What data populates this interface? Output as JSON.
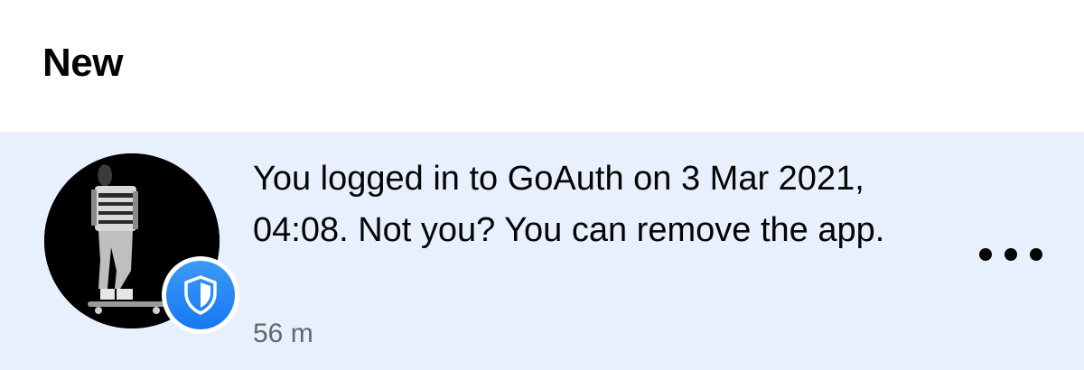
{
  "section": {
    "title": "New"
  },
  "notification": {
    "avatar_icon": "user-avatar-photo",
    "badge_icon": "shield-icon",
    "message": "You logged in to GoAuth on 3 Mar 2021, 04:08. Not you? You can remove the app.",
    "time": "56 m",
    "more_icon": "more-horizontal-icon",
    "background_color": "#e7f0fc",
    "badge_color": "#1877f2"
  }
}
